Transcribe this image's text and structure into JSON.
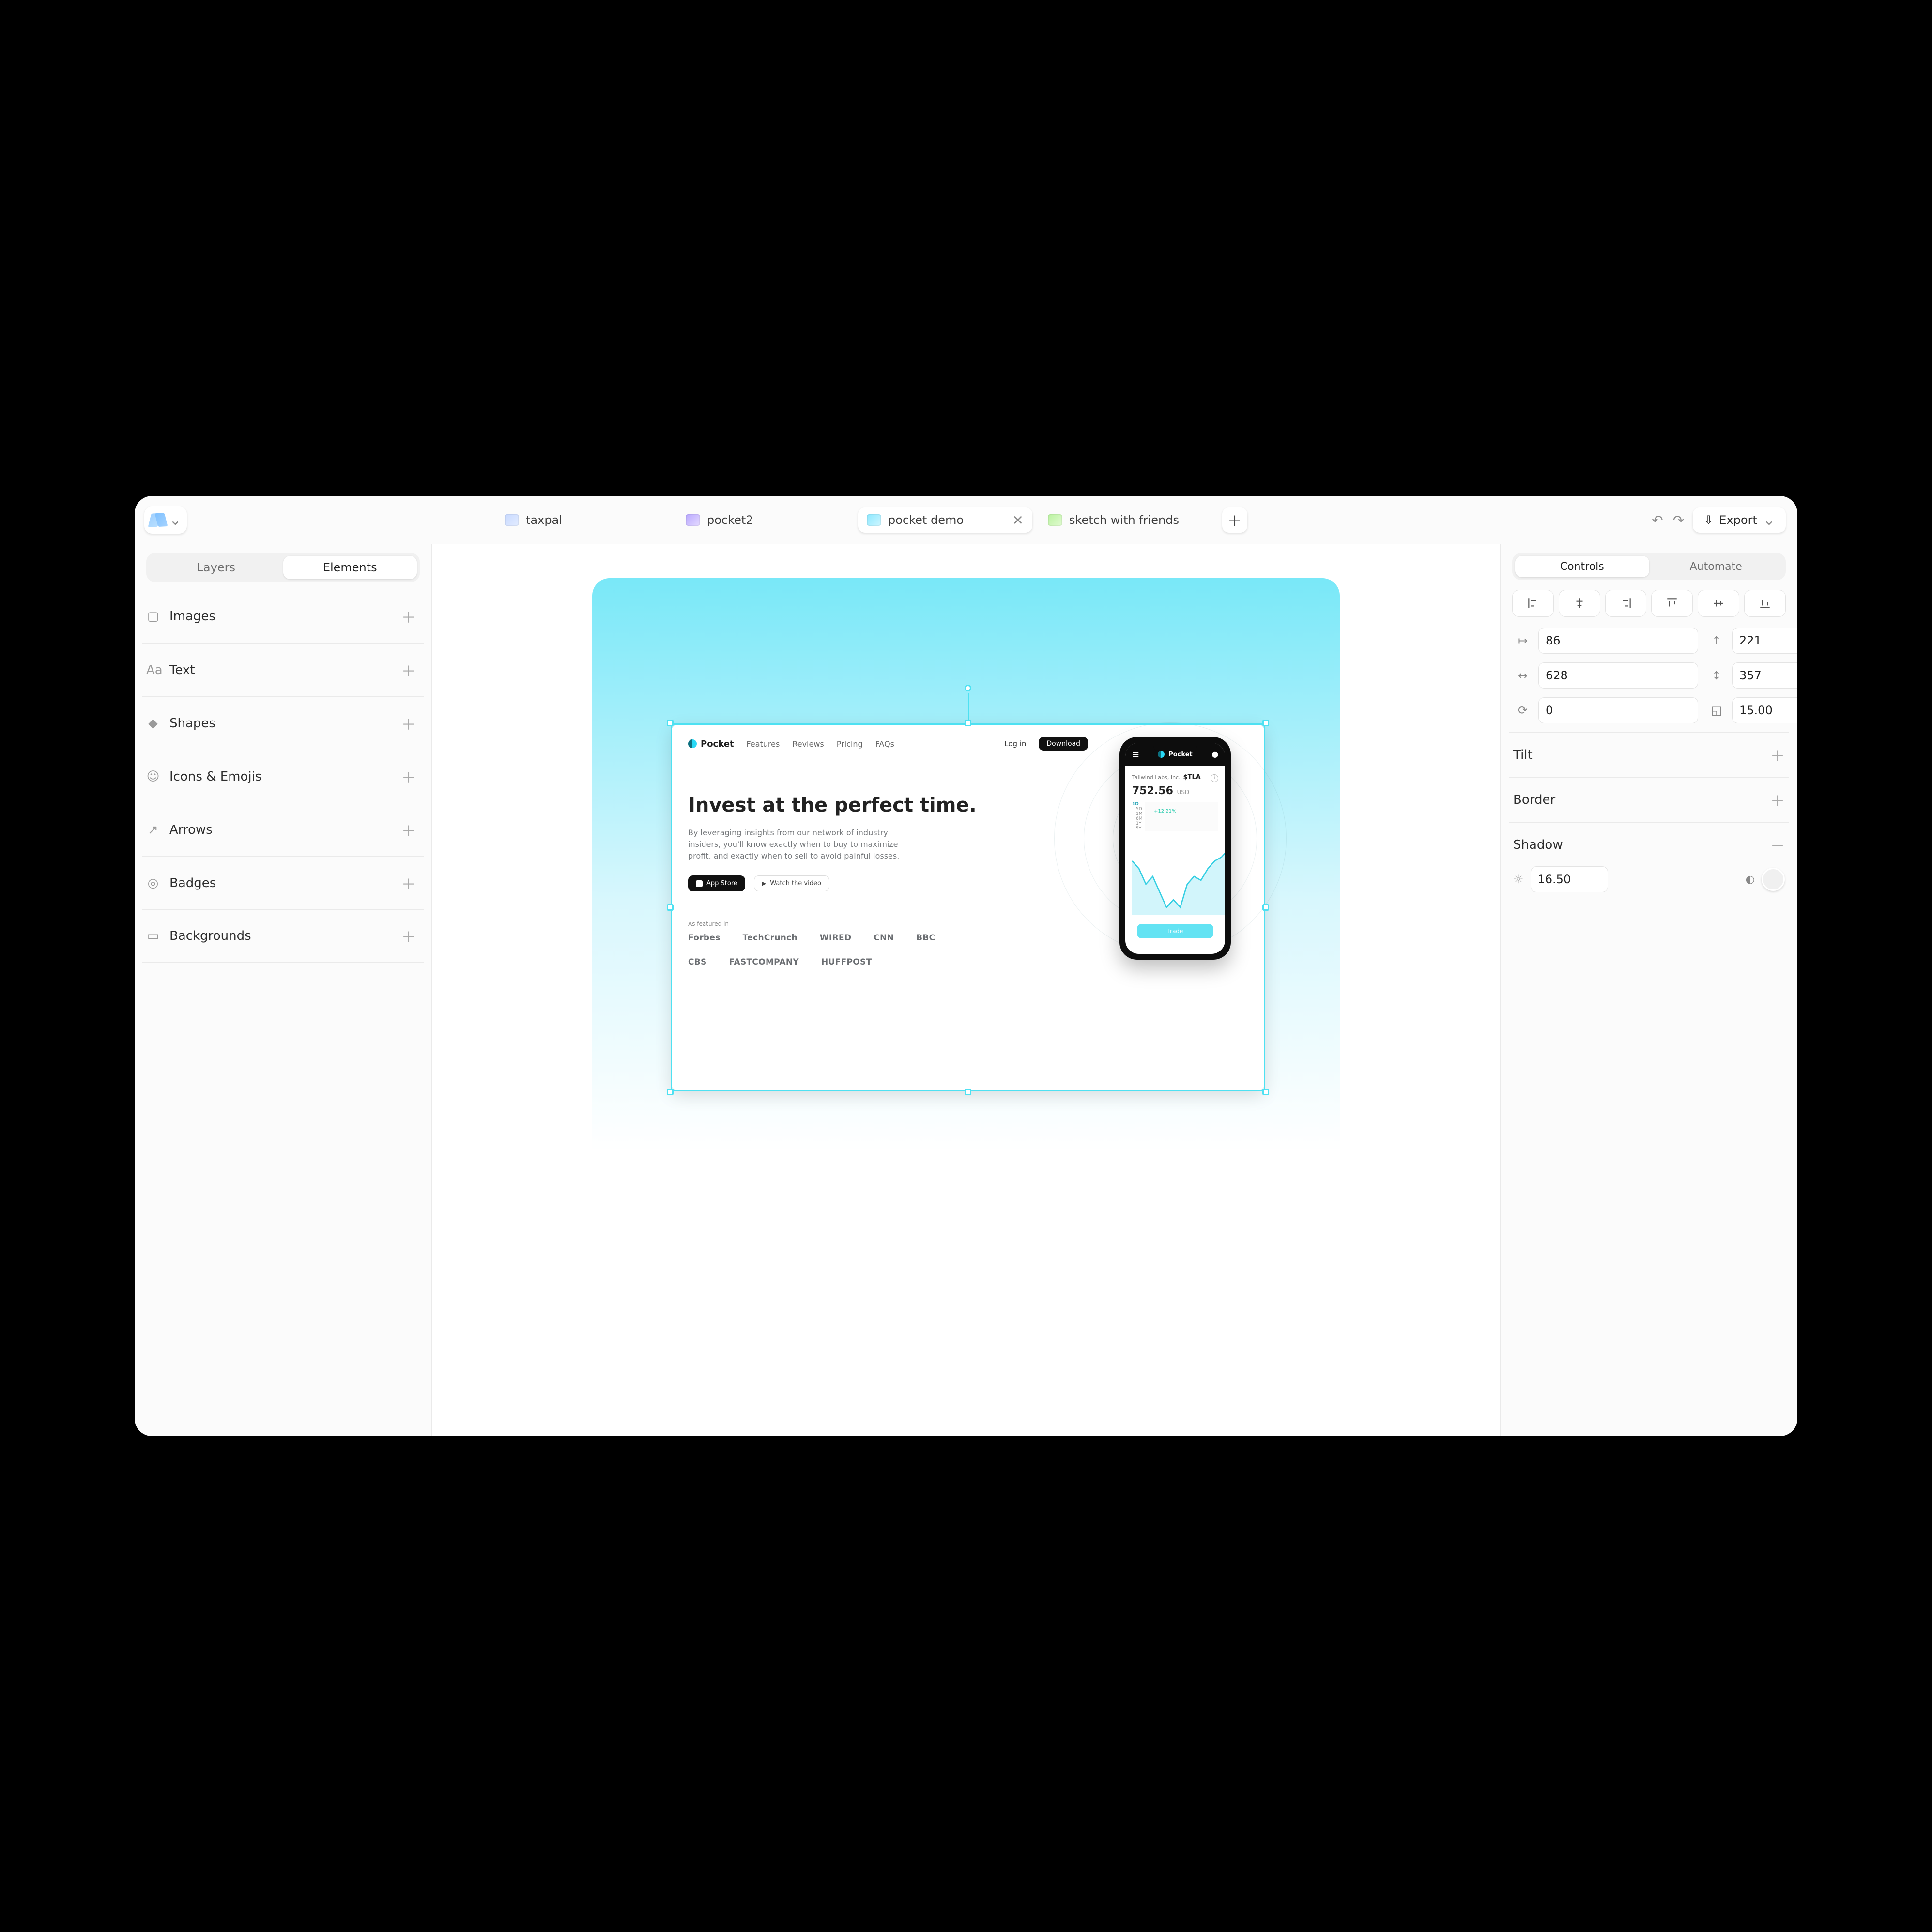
{
  "tabs": [
    {
      "label": "taxpal",
      "color": "blue",
      "active": false
    },
    {
      "label": "pocket2",
      "color": "purple",
      "active": false
    },
    {
      "label": "pocket demo",
      "color": "cyan",
      "active": true
    },
    {
      "label": "sketch with friends",
      "color": "green",
      "active": false
    }
  ],
  "export_label": "Export",
  "left": {
    "seg": {
      "a": "Layers",
      "b": "Elements",
      "active": "b"
    },
    "cats": [
      {
        "icon": "image",
        "label": "Images"
      },
      {
        "icon": "text",
        "label": "Text"
      },
      {
        "icon": "shape",
        "label": "Shapes"
      },
      {
        "icon": "emoji",
        "label": "Icons & Emojis"
      },
      {
        "icon": "arrow",
        "label": "Arrows"
      },
      {
        "icon": "badge",
        "label": "Badges"
      },
      {
        "icon": "bg",
        "label": "Backgrounds"
      }
    ]
  },
  "right": {
    "seg": {
      "a": "Controls",
      "b": "Automate",
      "active": "a"
    },
    "pos": {
      "x": "86",
      "y": "221"
    },
    "size": {
      "w": "628",
      "h": "357"
    },
    "rotation": "0",
    "radius": "15.00",
    "sections": [
      {
        "name": "Tilt",
        "open": false
      },
      {
        "name": "Border",
        "open": false
      },
      {
        "name": "Shadow",
        "open": true
      }
    ],
    "shadow_value": "16.50"
  },
  "card": {
    "brand": "Pocket",
    "nav": [
      "Features",
      "Reviews",
      "Pricing",
      "FAQs"
    ],
    "login": "Log in",
    "download": "Download",
    "headline": "Invest at the perfect time.",
    "sub": "By leveraging insights from our network of industry insiders, you'll know exactly when to buy to maximize profit, and exactly when to sell to avoid painful losses.",
    "appstore": "App Store",
    "watch": "Watch the video",
    "featured": "As featured in",
    "logos": [
      "Forbes",
      "TechCrunch",
      "WIRED",
      "CNN",
      "BBC",
      "CBS",
      "FASTCOMPANY",
      "HUFFPOST"
    ],
    "phone": {
      "brand": "Pocket",
      "ticker_label": "Tailwind Labs, Inc.",
      "ticker": "$TLA",
      "price": "752.56",
      "currency": "USD",
      "change": "+12.21%",
      "ranges": [
        "1D",
        "5D",
        "1M",
        "6M",
        "1Y",
        "5Y"
      ],
      "range_active": "1D",
      "trade": "Trade"
    }
  },
  "chart_data": {
    "type": "line",
    "title": "",
    "xlabel": "",
    "ylabel": "",
    "x": [
      0,
      1,
      2,
      3,
      4,
      5,
      6,
      7,
      8,
      9,
      10,
      11,
      12,
      13,
      14,
      15
    ],
    "values": [
      760,
      740,
      700,
      720,
      680,
      640,
      660,
      640,
      700,
      720,
      710,
      740,
      760,
      770,
      790,
      800
    ],
    "ylim": [
      620,
      820
    ]
  }
}
